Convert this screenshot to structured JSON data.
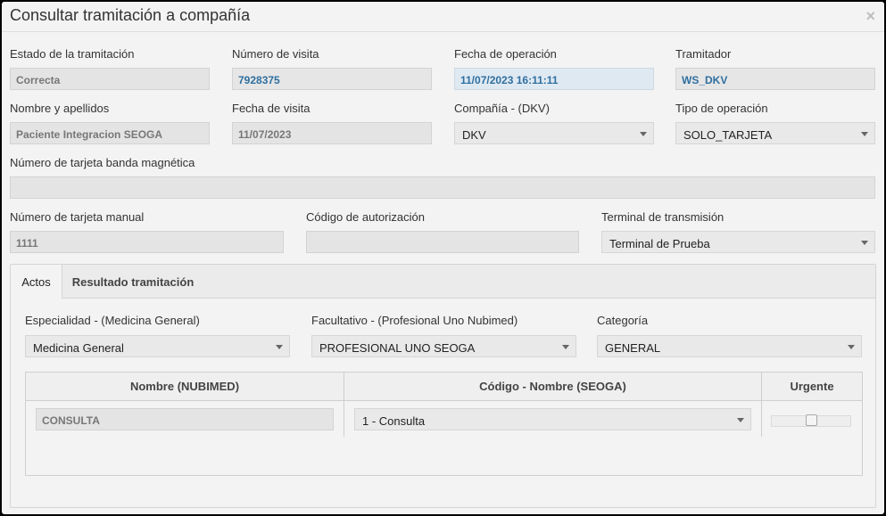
{
  "dialog": {
    "title": "Consultar tramitación a compañía",
    "close_glyph": "×"
  },
  "fields": {
    "estado_label": "Estado de la tramitación",
    "estado_value": "Correcta",
    "num_visita_label": "Número de visita",
    "num_visita_value": "7928375",
    "fecha_operacion_label": "Fecha de operación",
    "fecha_operacion_value": "11/07/2023 16:11:11",
    "tramitador_label": "Tramitador",
    "tramitador_value": "WS_DKV",
    "nombre_label": "Nombre y apellidos",
    "nombre_value": "Paciente Integracion SEOGA",
    "fecha_visita_label": "Fecha de visita",
    "fecha_visita_value": "11/07/2023",
    "compania_label": "Compañía - (DKV)",
    "compania_value": "DKV",
    "tipo_operacion_label": "Tipo de operación",
    "tipo_operacion_value": "SOLO_TARJETA",
    "tarjeta_banda_label": "Número de tarjeta banda magnética",
    "tarjeta_banda_value": "",
    "tarjeta_manual_label": "Número de tarjeta manual",
    "tarjeta_manual_value": "1111",
    "codigo_autorizacion_label": "Código de autorización",
    "codigo_autorizacion_value": "",
    "terminal_label": "Terminal de transmisión",
    "terminal_value": "Terminal de Prueba"
  },
  "tabs": [
    {
      "label": "Actos",
      "active": true
    },
    {
      "label": "Resultado tramitación",
      "active": false
    }
  ],
  "actos": {
    "especialidad_label": "Especialidad - (Medicina General)",
    "especialidad_value": "Medicina General",
    "facultativo_label": "Facultativo - (Profesional Uno Nubimed)",
    "facultativo_value": "PROFESIONAL UNO SEOGA",
    "categoria_label": "Categoría",
    "categoria_value": "GENERAL",
    "table": {
      "columns": [
        "Nombre (NUBIMED)",
        "Código - Nombre (SEOGA)",
        "Urgente"
      ],
      "rows": [
        {
          "nombre": "CONSULTA",
          "codigo": "1 - Consulta",
          "urgente": false
        }
      ]
    }
  },
  "icons": {
    "caret": "chevron-down-icon",
    "close": "close-icon"
  },
  "colors": {
    "background": "#f3f3f3",
    "value_blue": "#2f6fa0",
    "input_gray": "#e4e4e4"
  }
}
